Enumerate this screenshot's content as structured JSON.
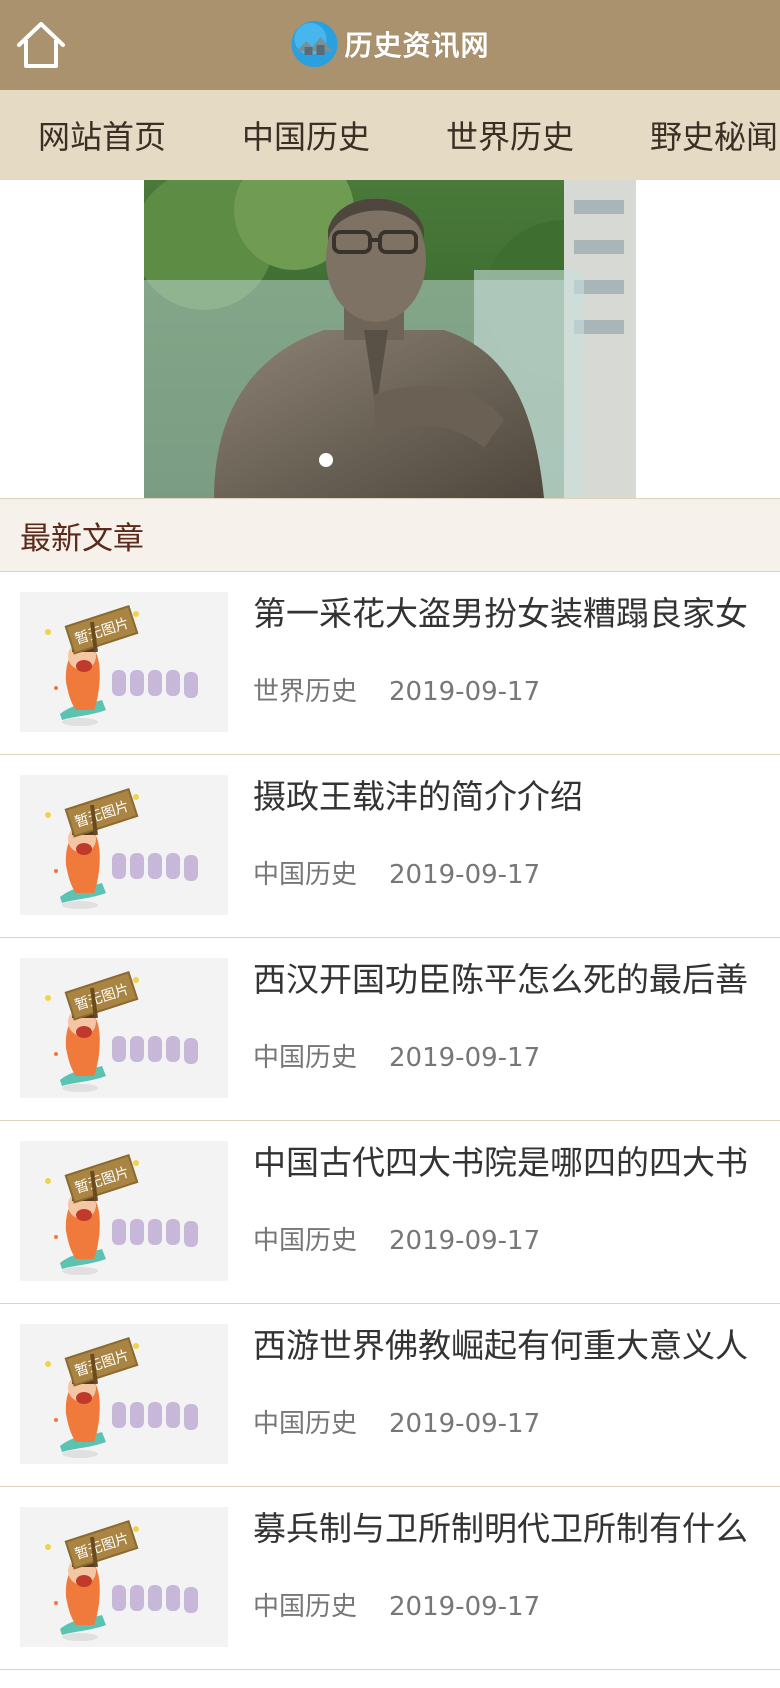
{
  "header": {
    "site_name": "历史资讯网",
    "home_icon": "home-icon",
    "logo_icon": "globe-house-icon",
    "background": "#a9926d"
  },
  "nav": {
    "items": [
      {
        "label": "网站首页"
      },
      {
        "label": "中国历史"
      },
      {
        "label": "世界历史"
      },
      {
        "label": "野史秘闻"
      }
    ]
  },
  "banner": {
    "image_subject": "bronze bust statue in front of glass monument",
    "slide_count": 1,
    "active_slide": 1
  },
  "latest": {
    "heading": "最新文章",
    "thumb_label": "暂无图片",
    "articles": [
      {
        "title": "第一采花大盗男扮女装糟蹋良家女",
        "category": "世界历史",
        "date": "2019-09-17"
      },
      {
        "title": "摄政王载沣的简介介绍",
        "category": "中国历史",
        "date": "2019-09-17"
      },
      {
        "title": "西汉开国功臣陈平怎么死的最后善",
        "category": "中国历史",
        "date": "2019-09-17"
      },
      {
        "title": "中国古代四大书院是哪四的四大书",
        "category": "中国历史",
        "date": "2019-09-17"
      },
      {
        "title": "西游世界佛教崛起有何重大意义人",
        "category": "中国历史",
        "date": "2019-09-17"
      },
      {
        "title": "募兵制与卫所制明代卫所制有什么",
        "category": "中国历史",
        "date": "2019-09-17"
      }
    ]
  }
}
